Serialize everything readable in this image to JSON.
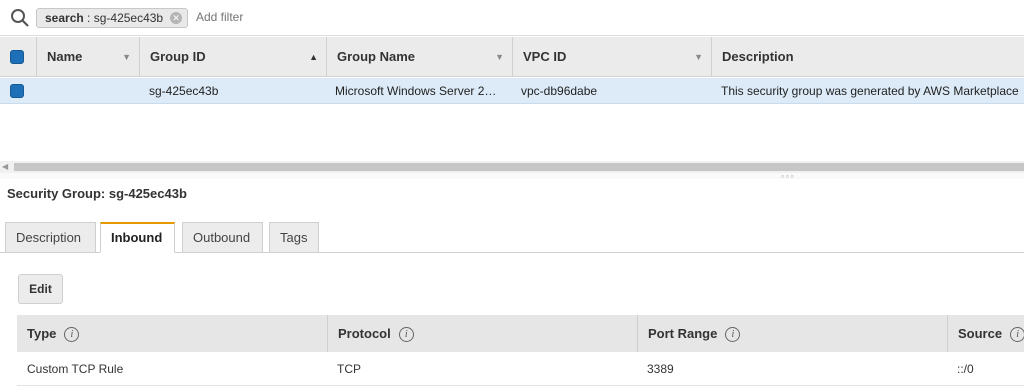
{
  "search": {
    "token_key": "search",
    "token_value": "sg-425ec43b",
    "placeholder": "Add filter"
  },
  "table": {
    "columns": [
      {
        "label": "Name",
        "sort": "▼"
      },
      {
        "label": "Group ID",
        "sort": "▲"
      },
      {
        "label": "Group Name",
        "sort": "▼"
      },
      {
        "label": "VPC ID",
        "sort": "▼"
      },
      {
        "label": "Description",
        "sort": ""
      }
    ],
    "rows": [
      {
        "name": "",
        "group_id": "sg-425ec43b",
        "group_name": "Microsoft Windows Server 2…",
        "vpc_id": "vpc-db96dabe",
        "description": "This security group was generated by AWS Marketplace"
      }
    ]
  },
  "detail": {
    "title": "Security Group: sg-425ec43b",
    "tabs": [
      "Description",
      "Inbound",
      "Outbound",
      "Tags"
    ],
    "active_tab": "Inbound",
    "edit_label": "Edit",
    "rules_columns": [
      "Type",
      "Protocol",
      "Port Range",
      "Source"
    ],
    "rules": [
      {
        "type": "Custom TCP Rule",
        "protocol": "TCP",
        "port_range": "3389",
        "source": "::/0"
      }
    ]
  },
  "colors": {
    "accent_tab": "#e59900",
    "selected_row": "#ddebf8",
    "checkbox": "#1d6fb8"
  },
  "icons": {
    "search": "search-icon",
    "token_close": "close-icon",
    "info": "info-icon"
  }
}
